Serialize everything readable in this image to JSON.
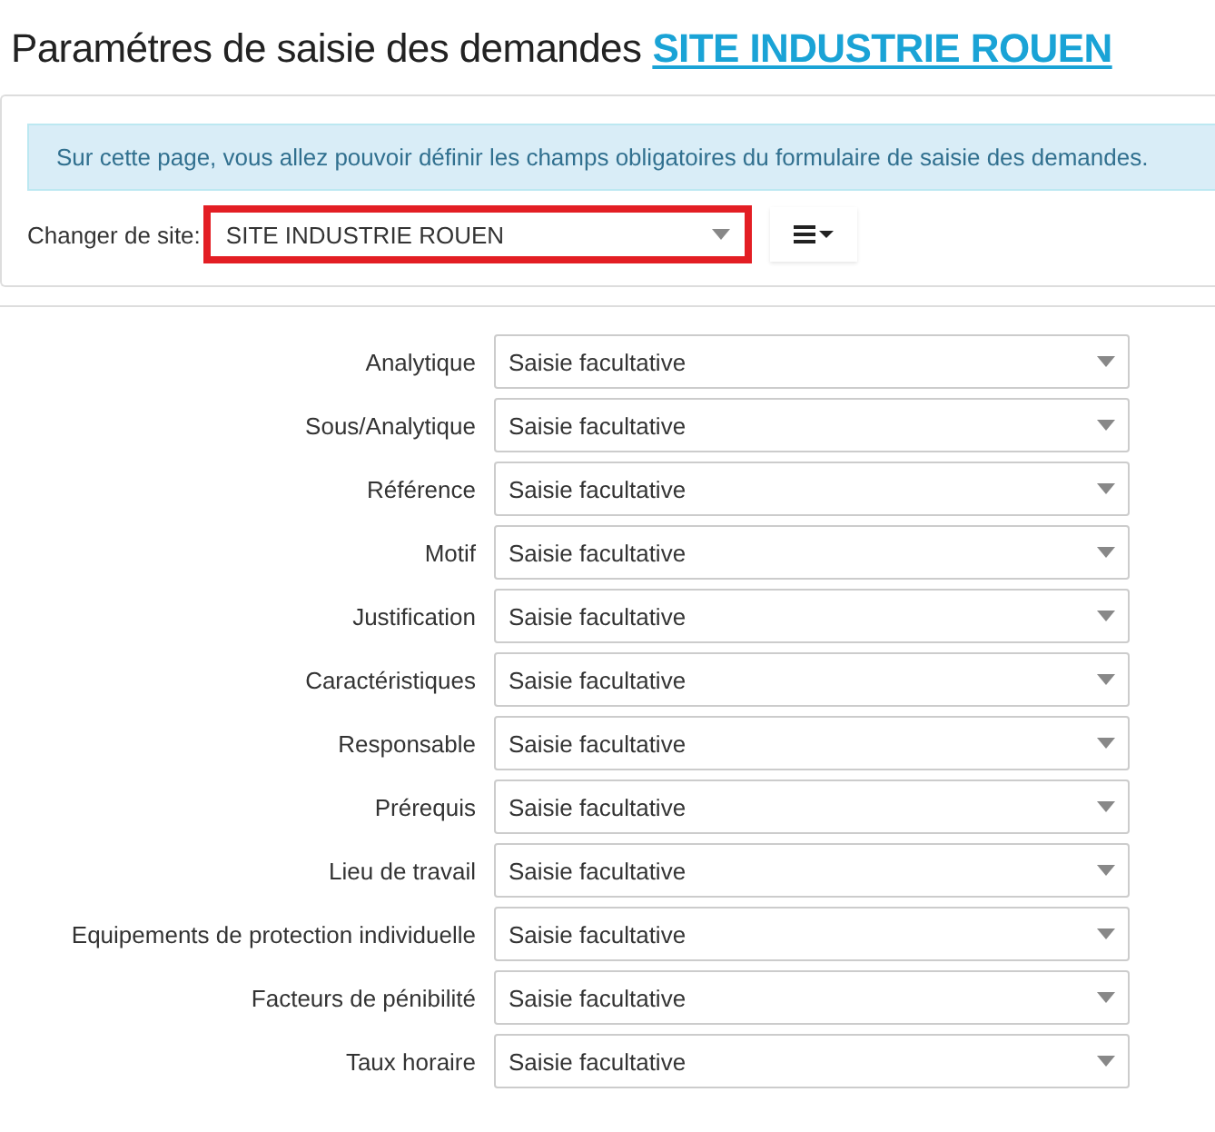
{
  "title": {
    "text": "Paramétres de saisie des demandes",
    "site_link": "SITE INDUSTRIE ROUEN"
  },
  "info": "Sur cette page, vous allez pouvoir définir les champs obligatoires du formulaire de saisie des demandes.",
  "site_selector": {
    "label": "Changer de site:",
    "value": "SITE INDUSTRIE ROUEN",
    "highlighted": true
  },
  "fields": [
    {
      "label": "Analytique",
      "value": "Saisie facultative"
    },
    {
      "label": "Sous/Analytique",
      "value": "Saisie facultative"
    },
    {
      "label": "Référence",
      "value": "Saisie facultative"
    },
    {
      "label": "Motif",
      "value": "Saisie facultative"
    },
    {
      "label": "Justification",
      "value": "Saisie facultative"
    },
    {
      "label": "Caractéristiques",
      "value": "Saisie facultative"
    },
    {
      "label": "Responsable",
      "value": "Saisie facultative"
    },
    {
      "label": "Prérequis",
      "value": "Saisie facultative"
    },
    {
      "label": "Lieu de travail",
      "value": "Saisie facultative"
    },
    {
      "label": "Equipements de protection individuelle",
      "value": "Saisie facultative"
    },
    {
      "label": "Facteurs de pénibilité",
      "value": "Saisie facultative"
    },
    {
      "label": "Taux horaire",
      "value": "Saisie facultative"
    }
  ]
}
